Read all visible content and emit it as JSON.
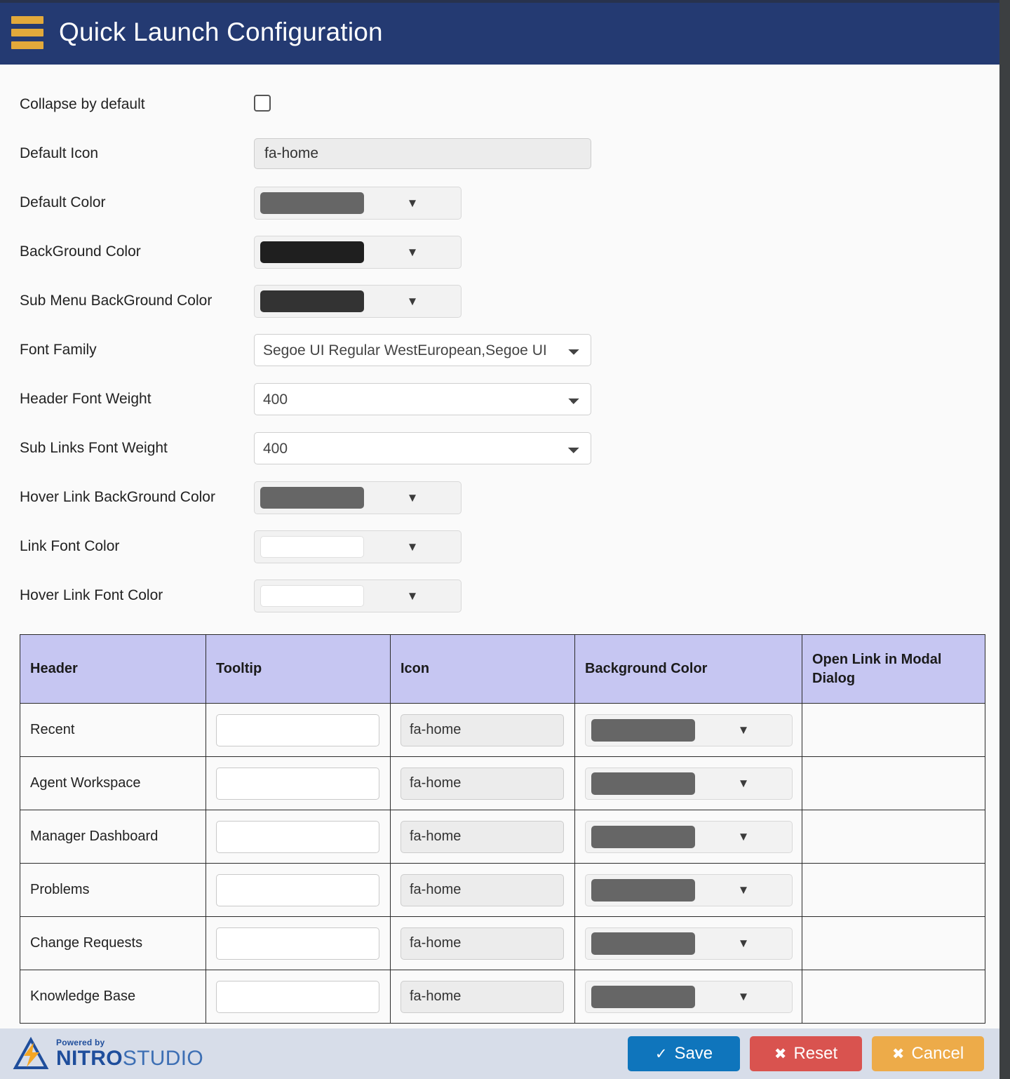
{
  "header": {
    "title": "Quick Launch Configuration",
    "menu_icon": "hamburger-icon",
    "bar_color": "#243a72",
    "icon_color": "#e2a93b"
  },
  "form": {
    "fields": [
      {
        "label": "Collapse by default",
        "type": "checkbox",
        "checked": false
      },
      {
        "label": "Default Icon",
        "type": "text",
        "value": "fa-home",
        "placeholder": ""
      },
      {
        "label": "Default Color",
        "type": "colorpicker",
        "value": "#666666"
      },
      {
        "label": "BackGround Color",
        "type": "colorpicker",
        "value": "#1f1f1f"
      },
      {
        "label": "Sub Menu BackGround Color",
        "type": "colorpicker",
        "value": "#333333"
      },
      {
        "label": "Font Family",
        "type": "select",
        "value": "Segoe UI Regular WestEuropean,Segoe UI"
      },
      {
        "label": "Header Font Weight",
        "type": "select",
        "value": "400"
      },
      {
        "label": "Sub Links Font Weight",
        "type": "select",
        "value": "400"
      },
      {
        "label": "Hover Link BackGround Color",
        "type": "colorpicker",
        "value": "#666666"
      },
      {
        "label": "Link Font Color",
        "type": "colorpicker",
        "value": "#ffffff"
      },
      {
        "label": "Hover Link Font Color",
        "type": "colorpicker",
        "value": "#ffffff"
      }
    ]
  },
  "table": {
    "header_bg": "#c6c6f2",
    "columns": [
      "Header",
      "Tooltip",
      "Icon",
      "Background Color",
      "Open Link in Modal Dialog"
    ],
    "rows": [
      {
        "header": "Recent",
        "tooltip": "",
        "icon": "fa-home",
        "background_color": "#666666",
        "modal": ""
      },
      {
        "header": "Agent Workspace",
        "tooltip": "",
        "icon": "fa-home",
        "background_color": "#666666",
        "modal": ""
      },
      {
        "header": "Manager Dashboard",
        "tooltip": "",
        "icon": "fa-home",
        "background_color": "#666666",
        "modal": ""
      },
      {
        "header": "Problems",
        "tooltip": "",
        "icon": "fa-home",
        "background_color": "#666666",
        "modal": ""
      },
      {
        "header": "Change Requests",
        "tooltip": "",
        "icon": "fa-home",
        "background_color": "#666666",
        "modal": ""
      },
      {
        "header": "Knowledge Base",
        "tooltip": "",
        "icon": "fa-home",
        "background_color": "#666666",
        "modal": ""
      }
    ]
  },
  "footer": {
    "logo": {
      "powered_by": "Powered by",
      "brand_bold": "NITRO",
      "brand_light": "STUDIO"
    },
    "buttons": [
      {
        "label": "Save",
        "glyph": "✓",
        "color": "#0f75bc",
        "name": "save-button"
      },
      {
        "label": "Reset",
        "glyph": "✖",
        "color": "#d9534f",
        "name": "reset-button"
      },
      {
        "label": "Cancel",
        "glyph": "✖",
        "color": "#edab49",
        "name": "cancel-button"
      }
    ]
  }
}
